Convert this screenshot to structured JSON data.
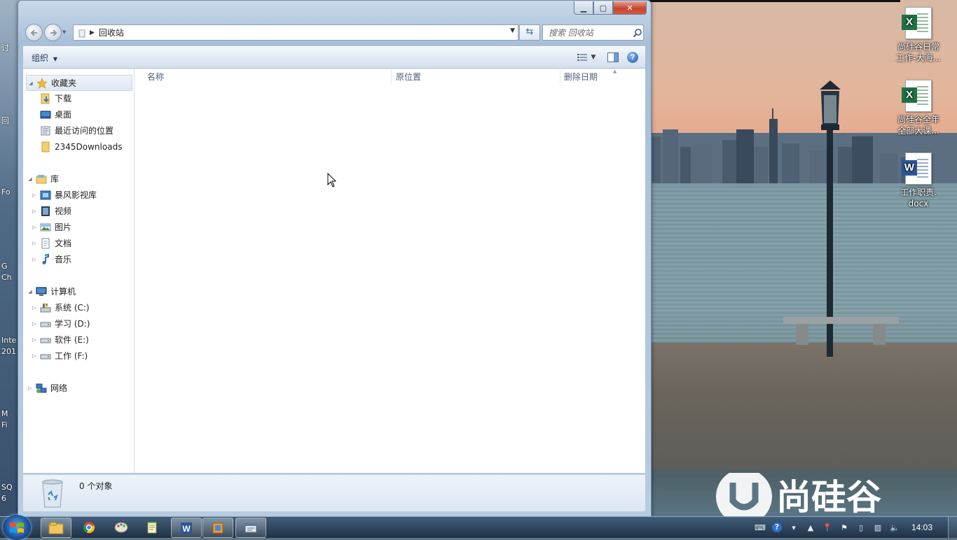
{
  "window": {
    "address_current": "回收站",
    "search_placeholder": "搜索 回收站",
    "toolbar": {
      "organize_label": "组织"
    },
    "nav": {
      "favorites": {
        "label": "收藏夹",
        "items": [
          "下载",
          "桌面",
          "最近访问的位置",
          "2345Downloads"
        ]
      },
      "libraries": {
        "label": "库",
        "items": [
          "暴风影视库",
          "视频",
          "图片",
          "文档",
          "音乐"
        ]
      },
      "computer": {
        "label": "计算机",
        "items": [
          "系统 (C:)",
          "学习 (D:)",
          "软件 (E:)",
          "工作 (F:)"
        ]
      },
      "network": {
        "label": "网络"
      }
    },
    "columns": [
      "名称",
      "原位置",
      "删除日期"
    ],
    "status": {
      "object_count": "0 个对象"
    }
  },
  "desktop": {
    "icons": [
      {
        "label_line1": "尚硅谷日常",
        "label_line2": "工作-大海...",
        "type": "excel"
      },
      {
        "label_line1": "尚硅谷全年",
        "label_line2": "全部大课...",
        "type": "excel"
      },
      {
        "label_line1": "工作职责.",
        "label_line2": "docx",
        "type": "word"
      }
    ],
    "left_strip_labels": [
      "讨",
      "回",
      "Fo",
      "G",
      "Ch",
      "Inte",
      "201",
      "M",
      "Fi",
      "SQ",
      "6"
    ],
    "brand_text": "尚硅谷"
  },
  "taskbar": {
    "clock": "14:03",
    "apps": [
      "explorer-icon",
      "chrome-icon",
      "paint-icon",
      "notepad-icon",
      "word-icon",
      "virtualbox-icon",
      "window-manager-icon"
    ]
  },
  "colors": {
    "accent": "#1e395b",
    "close_red": "#c8452f",
    "excel_green": "#1f7244",
    "word_blue": "#2b5797"
  }
}
